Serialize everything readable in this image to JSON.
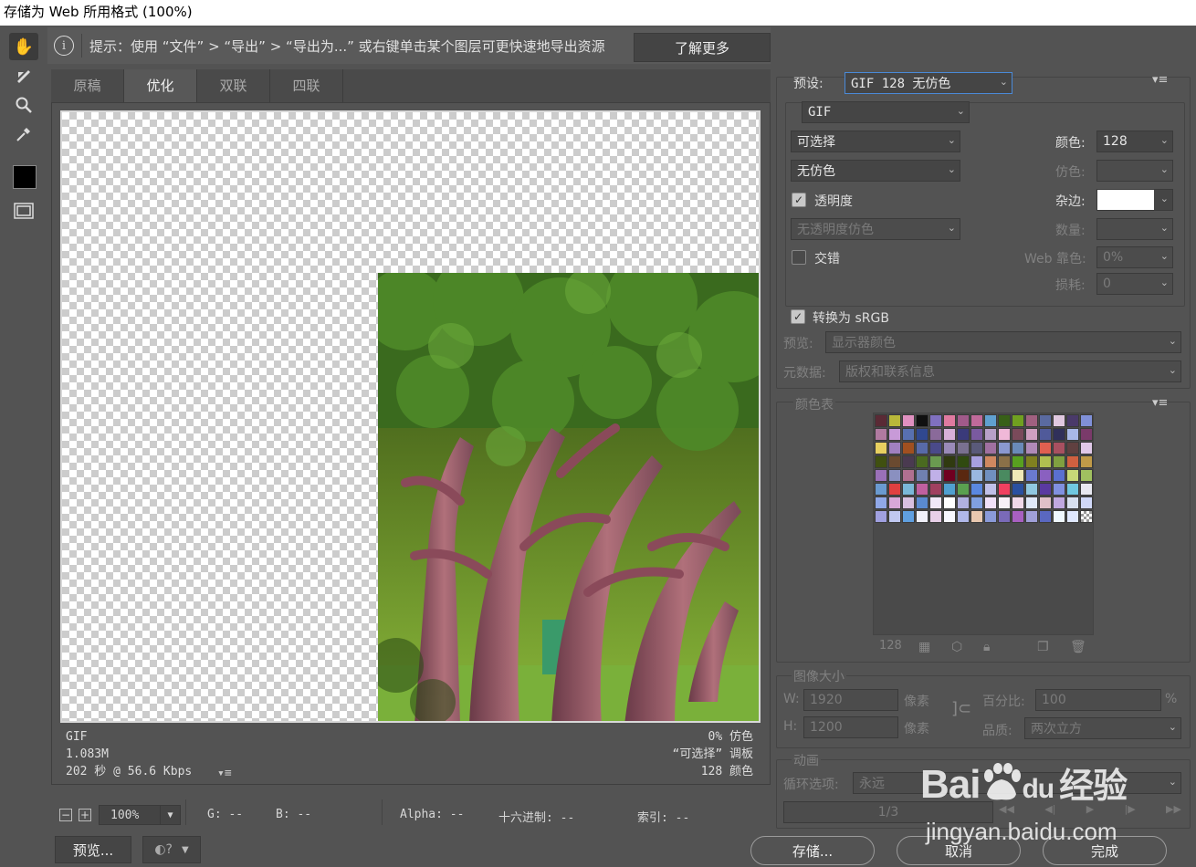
{
  "window": {
    "title": "存储为 Web 所用格式 (100%)"
  },
  "tip": {
    "label": "提示：使用 “文件” > “导出” > “导出为...” 或右键单击某个图层可更快速地导出资源",
    "learn_more": "了解更多"
  },
  "tabs": [
    {
      "label": "原稿"
    },
    {
      "label": "优化"
    },
    {
      "label": "双联"
    },
    {
      "label": "四联"
    }
  ],
  "image_info": {
    "format": "GIF",
    "size": "1.083M",
    "time": "202 秒 @ 56.6 Kbps",
    "dither": "0% 仿色",
    "palette": "“可选择” 调板",
    "colors": "128 颜色"
  },
  "status": {
    "zoom": "100%",
    "g": "G: --",
    "b": "B: --",
    "alpha": "Alpha: --",
    "hex": "十六进制: --",
    "index": "索引: --"
  },
  "buttons": {
    "preview": "预览...",
    "save": "存储...",
    "cancel": "取消",
    "done": "完成"
  },
  "settings": {
    "preset_label": "预设:",
    "preset": "GIF 128 无仿色",
    "format": "GIF",
    "reduction": "可选择",
    "colors_label": "颜色:",
    "colors": "128",
    "dither_algo": "无仿色",
    "dither_label": "仿色:",
    "dither": "",
    "transparency_label": "透明度",
    "matte_label": "杂边:",
    "trans_dither": "无透明度仿色",
    "amount_label": "数量:",
    "amount": "",
    "interlaced_label": "交错",
    "web_snap_label": "Web 靠色:",
    "web_snap": "0%",
    "lossy_label": "损耗:",
    "lossy": "0",
    "srgb_label": "转换为 sRGB",
    "preview_label": "预览:",
    "preview_value": "显示器颜色",
    "metadata_label": "元数据:",
    "metadata_value": "版权和联系信息"
  },
  "color_table": {
    "title": "颜色表",
    "count": "128",
    "colors": [
      "#5a2a35",
      "#b9b83a",
      "#e090c0",
      "#101010",
      "#8070c0",
      "#e07aa0",
      "#a05a8a",
      "#c06a9a",
      "#60a0d0",
      "#386018",
      "#70a020",
      "#a06080",
      "#5a6aa0",
      "#e0c8e0",
      "#4a3a6a",
      "#8090d8",
      "#b07aa0",
      "#c89ad8",
      "#5870b0",
      "#304890",
      "#8a6a9a",
      "#d8b0d8",
      "#3a3a7a",
      "#7a5aa0",
      "#b8a0c8",
      "#f0b8d8",
      "#7a4a5a",
      "#d0a0c0",
      "#505a9a",
      "#30305a",
      "#a8b8e8",
      "#7a3a6a",
      "#e8d060",
      "#a080c0",
      "#a05020",
      "#586aa8",
      "#4a4a8a",
      "#9a8ab8",
      "#7a7090",
      "#5a5a7a",
      "#a070a0",
      "#8a98d0",
      "#6a8ab8",
      "#b08ab8",
      "#e06050",
      "#a85060",
      "#604040",
      "#e0c8e8",
      "#405010",
      "#6a4a30",
      "#4a3a50",
      "#4a6a20",
      "#6a9a50",
      "#303a10",
      "#304a10",
      "#a8a0e0",
      "#d08860",
      "#8a7048",
      "#58a020",
      "#808020",
      "#b0c050",
      "#80a040",
      "#d06040",
      "#c09a48",
      "#9a70b8",
      "#8a90c0",
      "#b07090",
      "#7080b0",
      "#c0b0e8",
      "#700020",
      "#5a2810",
      "#9ab8e0",
      "#7090c0",
      "#4a8a60",
      "#f0e8b8",
      "#6a7ad0",
      "#8a60c0",
      "#5a70d0",
      "#c8d878",
      "#a0c060",
      "#6a9ad0",
      "#e04040",
      "#7ab8d8",
      "#c060a0",
      "#a04060",
      "#50a0d0",
      "#5aa050",
      "#5a88e0",
      "#c0c0e8",
      "#f04060",
      "#2a50a0",
      "#90c8e0",
      "#5a3aa0",
      "#8090e0",
      "#70c8e0",
      "#e8e8f0",
      "#90a8e8",
      "#d8a8d8",
      "#d8c0e0",
      "#5a8ad0",
      "#f0e8f8",
      "#ffffff",
      "#b0b0e0",
      "#80a0e0",
      "#f0e0f8",
      "#f8f0f8",
      "#f0d8e8",
      "#e0e8f8",
      "#e0c0c8",
      "#c0a8e0",
      "#d8e0f0",
      "#d0d8f8",
      "#a0a0e0",
      "#c0c8f0",
      "#60a0e0",
      "#f0f0f8",
      "#e8d0e8",
      "#f8f8ff",
      "#b0b8e8",
      "#e8c8b0",
      "#8a9ad8",
      "#7a6ab8",
      "#a860c0",
      "#a0a0d8",
      "#5a68c0",
      "#f0f8ff",
      "#e0e8ff",
      "#cccccc"
    ]
  },
  "image_size": {
    "title": "图像大小",
    "w_label": "W:",
    "w": "1920",
    "h_label": "H:",
    "h": "1200",
    "unit": "像素",
    "percent_label": "百分比:",
    "percent": "100",
    "percent_sign": "%",
    "quality_label": "品质:",
    "quality": "两次立方"
  },
  "animation": {
    "title": "动画",
    "loop_label": "循环选项:",
    "loop": "永远",
    "frame": "1/3"
  },
  "watermark": {
    "brand": "Bai",
    "brand2": "du",
    "brand3": "经验",
    "url": "jingyan.baidu.com"
  }
}
